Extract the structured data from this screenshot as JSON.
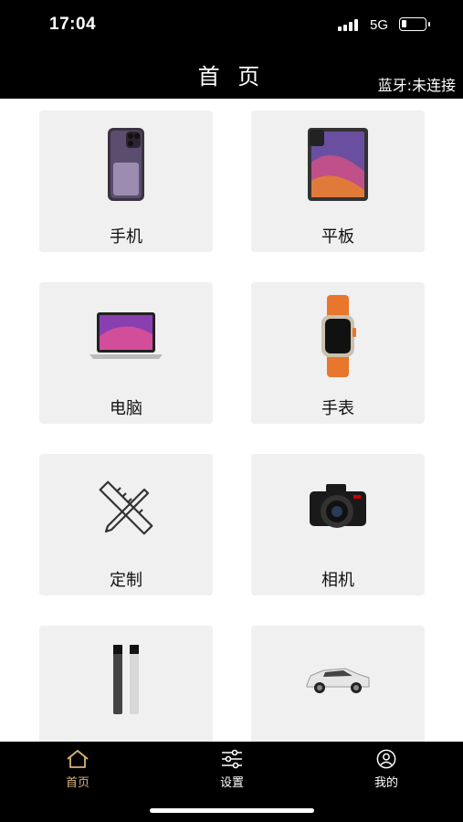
{
  "status_bar": {
    "time": "17:04",
    "network": "5G"
  },
  "header": {
    "title": "首 页",
    "bluetooth_status": "蓝牙:未连接"
  },
  "categories": [
    {
      "label": "手机",
      "icon": "smartphone-icon"
    },
    {
      "label": "平板",
      "icon": "tablet-icon"
    },
    {
      "label": "电脑",
      "icon": "laptop-icon"
    },
    {
      "label": "手表",
      "icon": "watch-icon"
    },
    {
      "label": "定制",
      "icon": "ruler-pencil-icon"
    },
    {
      "label": "相机",
      "icon": "camera-icon"
    },
    {
      "label": "",
      "icon": "vape-pen-icon"
    },
    {
      "label": "",
      "icon": "car-icon"
    }
  ],
  "tabbar": {
    "items": [
      {
        "label": "首页",
        "icon": "home-icon",
        "active": true
      },
      {
        "label": "设置",
        "icon": "sliders-icon",
        "active": false
      },
      {
        "label": "我的",
        "icon": "user-icon",
        "active": false
      }
    ]
  },
  "colors": {
    "accent": "#d9b37a",
    "bar": "#000000",
    "card": "#f0f0f0"
  }
}
